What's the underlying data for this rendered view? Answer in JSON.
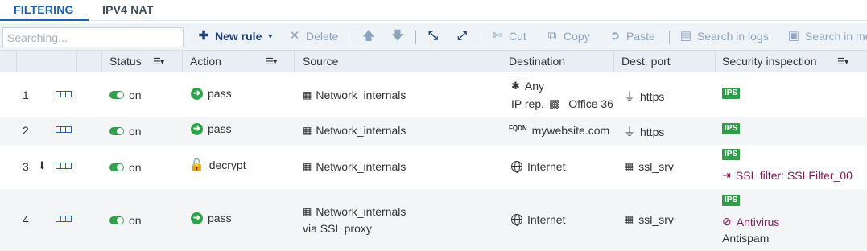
{
  "tabs": {
    "filtering": "FILTERING",
    "ipv4nat": "IPV4 NAT"
  },
  "toolbar": {
    "search_placeholder": "Searching...",
    "new_rule": "New rule",
    "delete": "Delete",
    "cut": "Cut",
    "copy": "Copy",
    "paste": "Paste",
    "search_in_logs": "Search in logs",
    "search_in_monitoring": "Search in mo"
  },
  "columns": {
    "status": "Status",
    "action": "Action",
    "source": "Source",
    "destination": "Destination",
    "dest_port": "Dest. port",
    "security": "Security inspection"
  },
  "rows": [
    {
      "num": "1",
      "status": "on",
      "action": "pass",
      "source": "Network_internals",
      "source2": "",
      "dest": "Any",
      "dest2_prefix": "IP rep.",
      "dest2_value": "Office 36",
      "port": "https",
      "ips": "IPS",
      "sec2": "",
      "sec3": ""
    },
    {
      "num": "2",
      "status": "on",
      "action": "pass",
      "source": "Network_internals",
      "source2": "",
      "dest": "mywebsite.com",
      "dest_prefix": "FQDN",
      "port": "https",
      "ips": "IPS",
      "sec2": "",
      "sec3": ""
    },
    {
      "num": "3",
      "status": "on",
      "action": "decrypt",
      "source": "Network_internals",
      "source2": "",
      "dest": "Internet",
      "port": "ssl_srv",
      "ips": "IPS",
      "sec2": "SSL filter: SSLFilter_00",
      "sec3": ""
    },
    {
      "num": "4",
      "status": "on",
      "action": "pass",
      "source": "Network_internals",
      "source2": "via SSL proxy",
      "dest": "Internet",
      "port": "ssl_srv",
      "ips": "IPS",
      "sec2": "Antivirus",
      "sec3": "Antispam"
    }
  ]
}
